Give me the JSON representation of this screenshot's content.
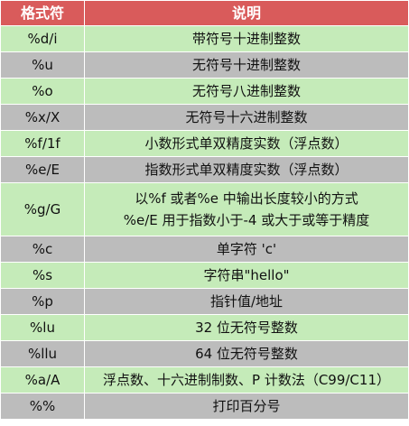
{
  "header": {
    "col_spec": "格式符",
    "col_desc": "说明"
  },
  "rows": [
    {
      "spec": "%d/i",
      "desc": [
        "带符号十进制整数"
      ]
    },
    {
      "spec": "%u",
      "desc": [
        "无符号十进制整数"
      ]
    },
    {
      "spec": "%o",
      "desc": [
        "无符号八进制整数"
      ]
    },
    {
      "spec": "%x/X",
      "desc": [
        "无符号十六进制整数"
      ]
    },
    {
      "spec": "%f/1f",
      "desc": [
        "小数形式单双精度实数（浮点数）"
      ]
    },
    {
      "spec": "%e/E",
      "desc": [
        "指数形式单双精度实数（浮点数）"
      ]
    },
    {
      "spec": "%g/G",
      "desc": [
        "以%f 或者%e 中输出长度较小的方式",
        "%e/E 用于指数小于-4 或大于或等于精度"
      ]
    },
    {
      "spec": "%c",
      "desc": [
        "单字符 'c'"
      ]
    },
    {
      "spec": "%s",
      "desc": [
        "字符串\"hello\""
      ]
    },
    {
      "spec": "%p",
      "desc": [
        "指针值/地址"
      ]
    },
    {
      "spec": "%lu",
      "desc": [
        "32 位无符号整数"
      ]
    },
    {
      "spec": "%llu",
      "desc": [
        "64 位无符号整数"
      ]
    },
    {
      "spec": "%a/A",
      "desc": [
        "浮点数、十六进制制数、P 计数法（C99/C11）"
      ]
    },
    {
      "spec": "%%",
      "desc": [
        "打印百分号"
      ]
    }
  ],
  "colors": {
    "header_bg": "#d95b5b",
    "row_green": "#c5ebb9",
    "row_gray": "#bcbcbc"
  }
}
